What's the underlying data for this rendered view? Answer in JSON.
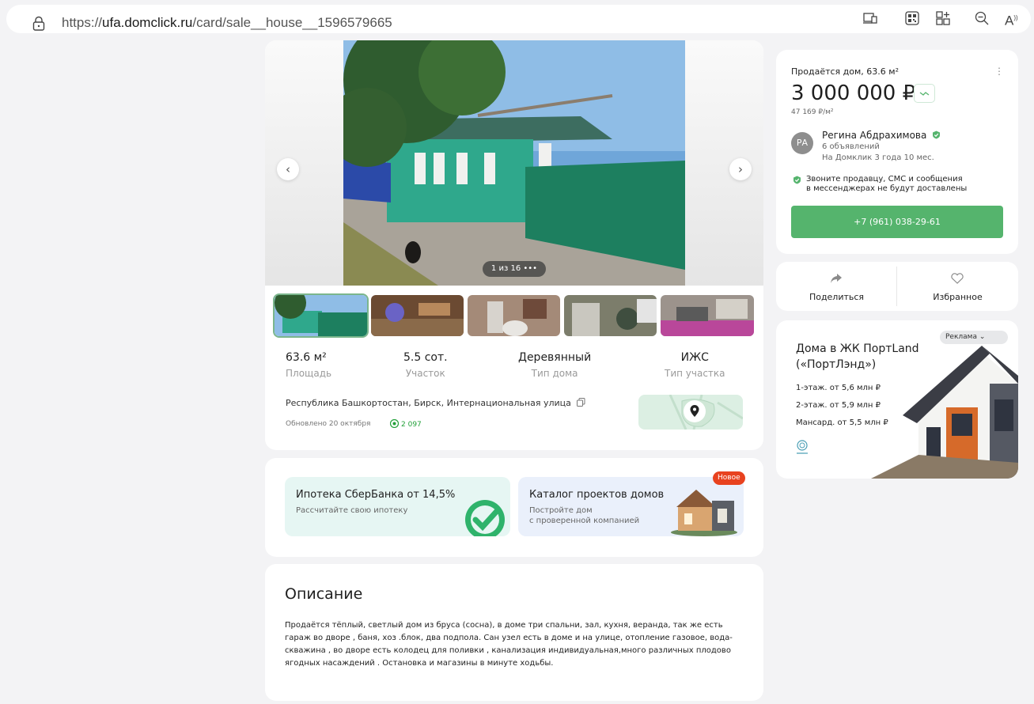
{
  "browser": {
    "url_prefix": "https://",
    "url_domain": "ufa.domclick.ru",
    "url_path": "/card/sale__house__1596579665",
    "toolbar_icons": [
      "device-preview-icon",
      "qr-code-icon",
      "apps-add-icon",
      "zoom-out-icon",
      "read-aloud-icon"
    ],
    "read_aloud_glyph": "A"
  },
  "gallery": {
    "counter": "1 из 16 •••",
    "prev_glyph": "‹",
    "next_glyph": "›",
    "thumbnail_count": 5
  },
  "stats": [
    {
      "value": "63.6 м²",
      "label": "Площадь"
    },
    {
      "value": "5.5 сот.",
      "label": "Участок"
    },
    {
      "value": "Деревянный",
      "label": "Тип дома"
    },
    {
      "value": "ИЖС",
      "label": "Тип участка"
    }
  ],
  "location": {
    "address": "Республика Башкортостан, Бирск, Интернациональная улица",
    "updated": "Обновлено 20 октября",
    "views": "2 097"
  },
  "promos": {
    "mortgage_title": "Ипотека СберБанка от 14,5%",
    "mortgage_sub": "Рассчитайте свою ипотеку",
    "catalog_title": "Каталог проектов домов",
    "catalog_sub_1": "Постройте дом",
    "catalog_sub_2": "с проверенной компанией",
    "badge": "Новое"
  },
  "description": {
    "title": "Описание",
    "text": "Продаётся тёплый, светлый дом из бруса (сосна), в доме три спальни, зал, кухня, веранда, так же есть гараж во дворе , баня, хоз .блок, два подпола. Сан узел есть в доме и на улице, отопление газовое, вода- скважина , во дворе есть колодец для поливки , канализация индивидуальная,много различных плодово ягодных насаждений . Остановка и магазины в минуте ходьбы."
  },
  "listing": {
    "title": "Продаётся дом, 63.6 м²",
    "price": "3 000 000 ₽",
    "price_per_m2": "47 169 ₽/м²",
    "menu_glyph": "⋮"
  },
  "seller": {
    "initials": "РА",
    "name": "Регина Абдрахимова",
    "ads": "6 объявлений",
    "tenure": "На Домклик 3 года 10 мес."
  },
  "notice": {
    "line1": "Звоните продавцу, СМС и сообщения",
    "line2": "в мессенджерах не будут доставлены"
  },
  "phone": "+7 (961) 038-29-61",
  "actions": {
    "share": "Поделиться",
    "favorite": "Избранное"
  },
  "ad": {
    "label": "Реклама",
    "title": "Дома в ЖК ПортLand («ПортЛэнд»)",
    "line1": "1-этаж. от 5,6 млн ₽",
    "line2": "2-этаж. от 5,9 млн ₽",
    "line3": "Мансард. от 5,5 млн ₽"
  },
  "colors": {
    "accent_green": "#55b46d",
    "badge_red": "#e8421f",
    "verified_green": "#21a038"
  }
}
